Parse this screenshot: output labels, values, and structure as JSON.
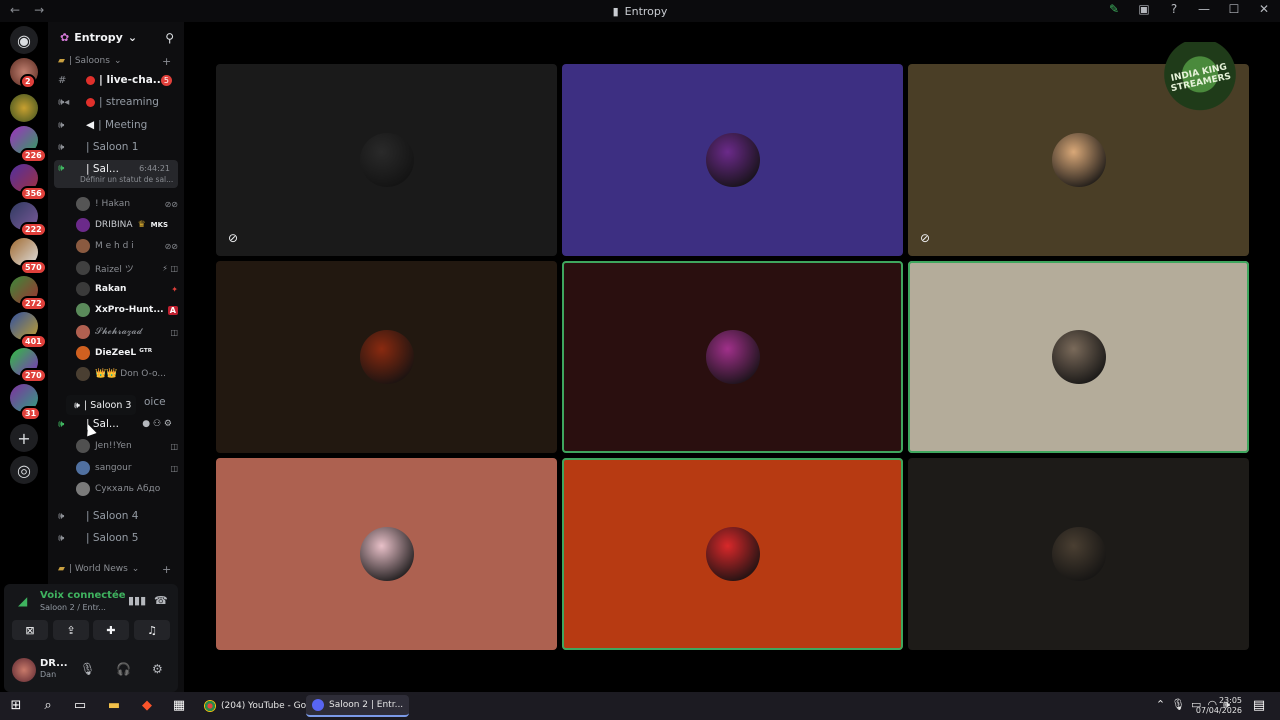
{
  "window": {
    "title": "Entropy"
  },
  "server": {
    "name": "Entropy"
  },
  "categories": [
    {
      "label": "| Saloons"
    },
    {
      "label": "| World News"
    }
  ],
  "channels": [
    {
      "label": "| live-cha...",
      "badge": "5"
    },
    {
      "label": "| streaming"
    },
    {
      "label": "| Meeting"
    },
    {
      "label": "| Saloon 1"
    },
    {
      "label": "| Sal...",
      "time": "6:44:21",
      "sub": "Définir un statut de sal..."
    },
    {
      "label": "| Sal..."
    },
    {
      "label": "| Saloon 4"
    },
    {
      "label": "| Saloon 5"
    }
  ],
  "hidden_channel_fragment": "oice",
  "tooltip": {
    "label": "| Saloon 3"
  },
  "saloon2_users": [
    {
      "name": "! Hakan"
    },
    {
      "name": "DRIBINA",
      "tag": "MKS"
    },
    {
      "name": "M e h d i"
    },
    {
      "name": "Raizel ツ"
    },
    {
      "name": "Rakan"
    },
    {
      "name": "XxPro-Hunt..."
    },
    {
      "name": "𝓢𝓱𝓮𝓱𝓻𝓪𝔃𝓪𝓭"
    },
    {
      "name": "DieZeeL ᴳᵀᴿ"
    },
    {
      "name": "👑👑 Don O-o..."
    }
  ],
  "saloon_users": [
    {
      "name": "Jen!!Yen"
    },
    {
      "name": "sangour"
    },
    {
      "name": "Сукхаль Абдо"
    }
  ],
  "guild_badges": [
    "2",
    "226",
    "356",
    "222",
    "570",
    "272",
    "401",
    "270",
    "31"
  ],
  "voice": {
    "status": "Voix connectée",
    "channel": "Saloon 2 / Entr..."
  },
  "user": {
    "name": "DR...",
    "status": "Dan"
  },
  "stage": {
    "logo_text": "INDIA KING STREAMERS",
    "tiles": [
      {
        "bg": "#1a1a1a",
        "avatar": "#2a2a2a",
        "muted": true
      },
      {
        "bg": "#3d2f82",
        "avatar": "#6b2a8a",
        "muted": false
      },
      {
        "bg": "#4a3e26",
        "avatar": "#d9a878",
        "muted": true
      },
      {
        "bg": "#221810",
        "avatar": "#8a2a10",
        "muted": false
      },
      {
        "bg": "#2a0f0f",
        "avatar": "#a0308a",
        "muted": false,
        "speaking": true
      },
      {
        "bg": "#b4ac9a",
        "avatar": "#7a6a5a",
        "muted": false,
        "speaking": true
      },
      {
        "bg": "#ad6150",
        "avatar": "#e8c0c8",
        "muted": false
      },
      {
        "bg": "#b73a12",
        "avatar": "#d8282a",
        "muted": false,
        "speaking": true
      },
      {
        "bg": "#1d1b18",
        "avatar": "#4a3f32",
        "muted": false
      }
    ]
  },
  "taskbar": {
    "apps": [
      {
        "label": "(204) YouTube - Go..."
      },
      {
        "label": "Saloon 2 | Entr..."
      }
    ],
    "time": "23:05",
    "date": "07/04/2026"
  },
  "colors": {
    "accent": "#3fa65e",
    "badge": "#e0403b"
  }
}
